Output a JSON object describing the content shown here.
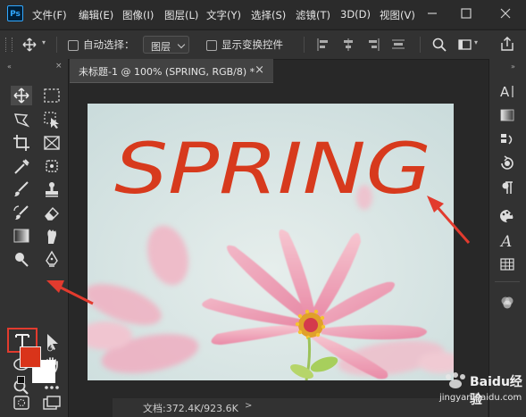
{
  "app": {
    "logo_text": "Ps"
  },
  "menu": {
    "items": [
      "文件(F)",
      "编辑(E)",
      "图像(I)",
      "图层(L)",
      "文字(Y)",
      "选择(S)",
      "滤镜(T)",
      "3D(D)",
      "视图(V)"
    ]
  },
  "options": {
    "auto_select_label": "自动选择：",
    "layer_dropdown_value": "图层",
    "show_transform_label": "显示变换控件"
  },
  "document": {
    "tab_title": "未标题-1 @ 100% (SPRING, RGB/8) *",
    "close_glyph": "×",
    "image_text": "SPRING",
    "text_color": "#d73a1d"
  },
  "status": {
    "doc_info": "文档:372.4K/923.6K"
  },
  "colors": {
    "foreground": "#d9341a",
    "background": "#ffffff",
    "highlight": "#e23b2e"
  },
  "watermark": {
    "brand": "Baidu经验",
    "url": "jingyan.baidu.com"
  }
}
